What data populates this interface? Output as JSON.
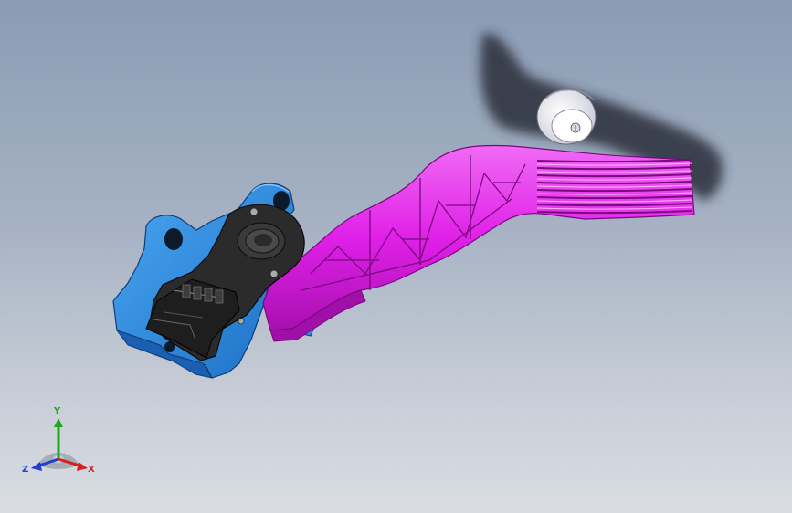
{
  "viewport": {
    "background_top": "#8a9bb3",
    "background_bottom": "#d9dde3"
  },
  "model": {
    "pedal_arm_color": "#e020e8",
    "bracket_color": "#2f8fe6",
    "sensor_color": "#2b2b2b",
    "stopper_color": "#f4f4fa"
  },
  "triad": {
    "x_label": "X",
    "y_label": "Y",
    "z_label": "Z",
    "x_color": "#d42020",
    "y_color": "#1fa81f",
    "z_color": "#1f3fd4"
  }
}
